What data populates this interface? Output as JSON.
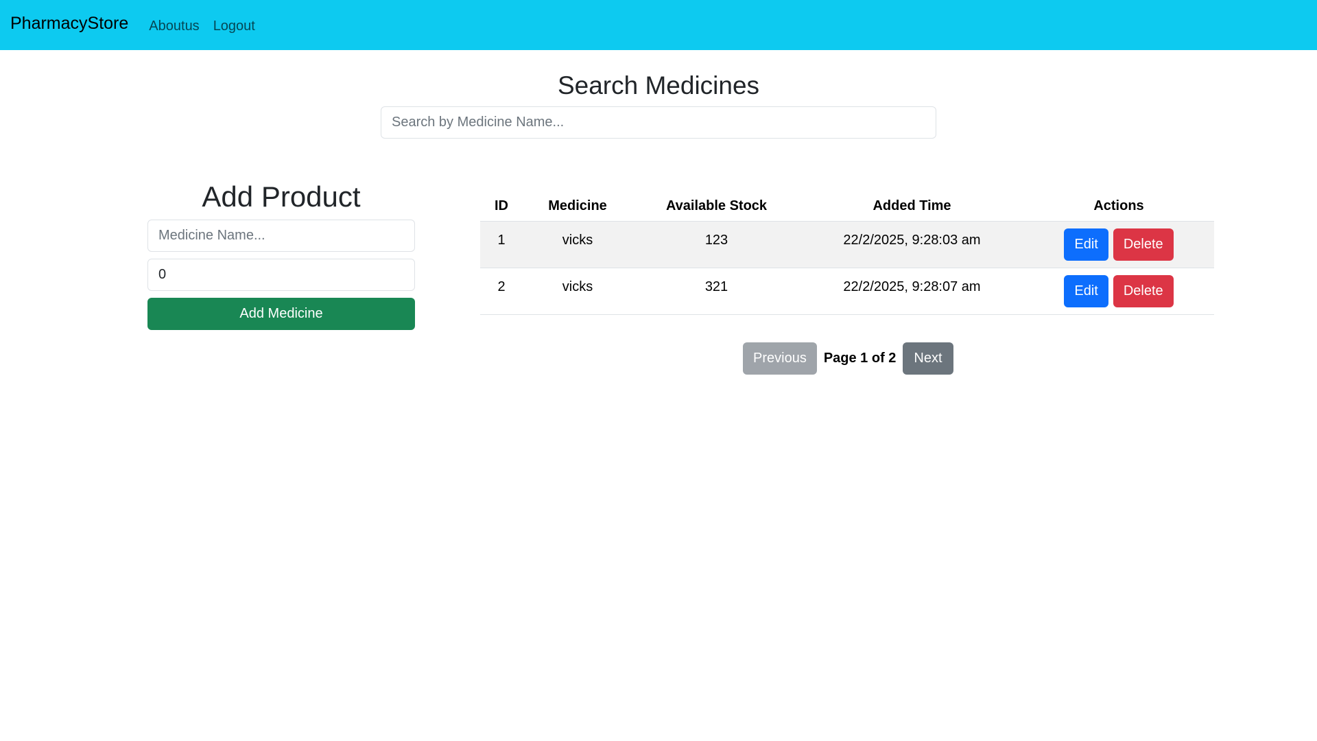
{
  "navbar": {
    "brand": "PharmacyStore",
    "links": [
      "Aboutus",
      "Logout"
    ],
    "background": "#0dcaf0"
  },
  "search": {
    "title": "Search Medicines",
    "placeholder": "Search by Medicine Name..."
  },
  "add_product": {
    "title": "Add Product",
    "name_placeholder": "Medicine Name...",
    "quantity_value": "0",
    "button_label": "Add Medicine",
    "button_color": "#198754"
  },
  "table": {
    "headers": [
      "ID",
      "Medicine",
      "Available Stock",
      "Added Time",
      "Actions"
    ],
    "rows": [
      {
        "id": "1",
        "medicine": "vicks",
        "stock": "123",
        "added_time": "22/2/2025, 9:28:03 am"
      },
      {
        "id": "2",
        "medicine": "vicks",
        "stock": "321",
        "added_time": "22/2/2025, 9:28:07 am"
      }
    ],
    "edit_label": "Edit",
    "delete_label": "Delete",
    "edit_color": "#0d6efd",
    "delete_color": "#dc3545"
  },
  "pagination": {
    "previous_label": "Previous",
    "page_text": "Page 1 of 2",
    "next_label": "Next"
  }
}
